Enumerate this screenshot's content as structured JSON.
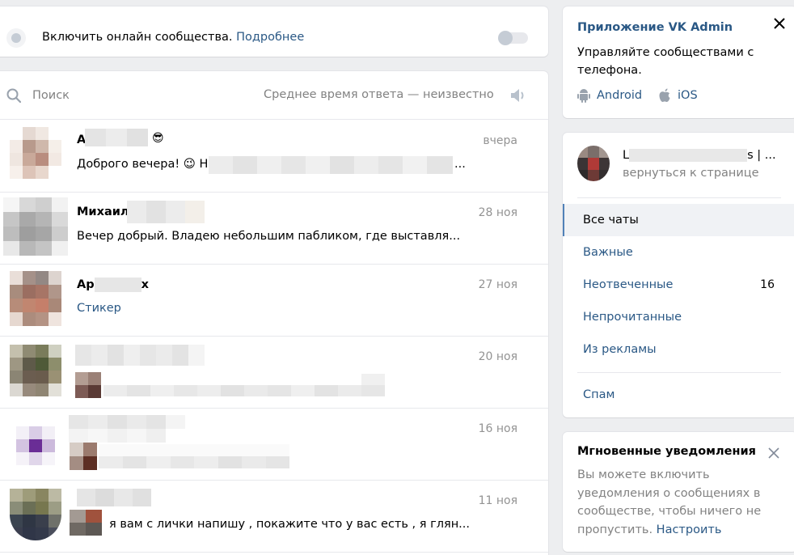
{
  "online": {
    "label": "Включить онлайн сообщества.",
    "link": "Подробнее"
  },
  "search": {
    "placeholder": "Поиск",
    "response_time": "Среднее время ответа — неизвестно"
  },
  "dialogs": [
    {
      "name": "А",
      "name_suffix": "😎",
      "date": "вчера",
      "preview": "Доброго вечера! 😉 Н",
      "preview_end": "..."
    },
    {
      "name": "Михаил",
      "date": "28 ноя",
      "preview": "Вечер добрый. Владею небольшим пабликом, где выставля..."
    },
    {
      "name": "Ар",
      "name_end": "х",
      "date": "27 ноя",
      "preview": "Стикер"
    },
    {
      "name": "",
      "date": "20 ноя",
      "preview": ""
    },
    {
      "name": "",
      "date": "16 ноя",
      "preview": ""
    },
    {
      "name": "",
      "date": "11 ноя",
      "preview": "я вам с лички напишу , покажите что у вас есть , я глян..."
    }
  ],
  "admin_app": {
    "title": "Приложение VK Admin",
    "description": "Управляйте сообществами с телефона.",
    "android": "Android",
    "ios": "iOS"
  },
  "community": {
    "name_start": "L",
    "name_end": "s | ...",
    "back": "вернуться к странице"
  },
  "menu": {
    "all_chats": "Все чаты",
    "important": "Важные",
    "unanswered": "Неотвеченные",
    "unanswered_count": "16",
    "unread": "Непрочитанные",
    "from_ads": "Из рекламы",
    "spam": "Спам"
  },
  "notifications": {
    "title": "Мгновенные уведомления",
    "text": "Вы можете включить уведомления о сообщениях в сообществе, чтобы ничего не пропустить.",
    "link": "Настроить"
  },
  "icons": {
    "search": "search-icon",
    "sound": "speaker-icon",
    "close": "close-icon",
    "android": "android-icon",
    "apple": "apple-icon"
  },
  "colors": {
    "accent": "#2a5885",
    "muted": "#828282",
    "background": "#edeef0"
  }
}
